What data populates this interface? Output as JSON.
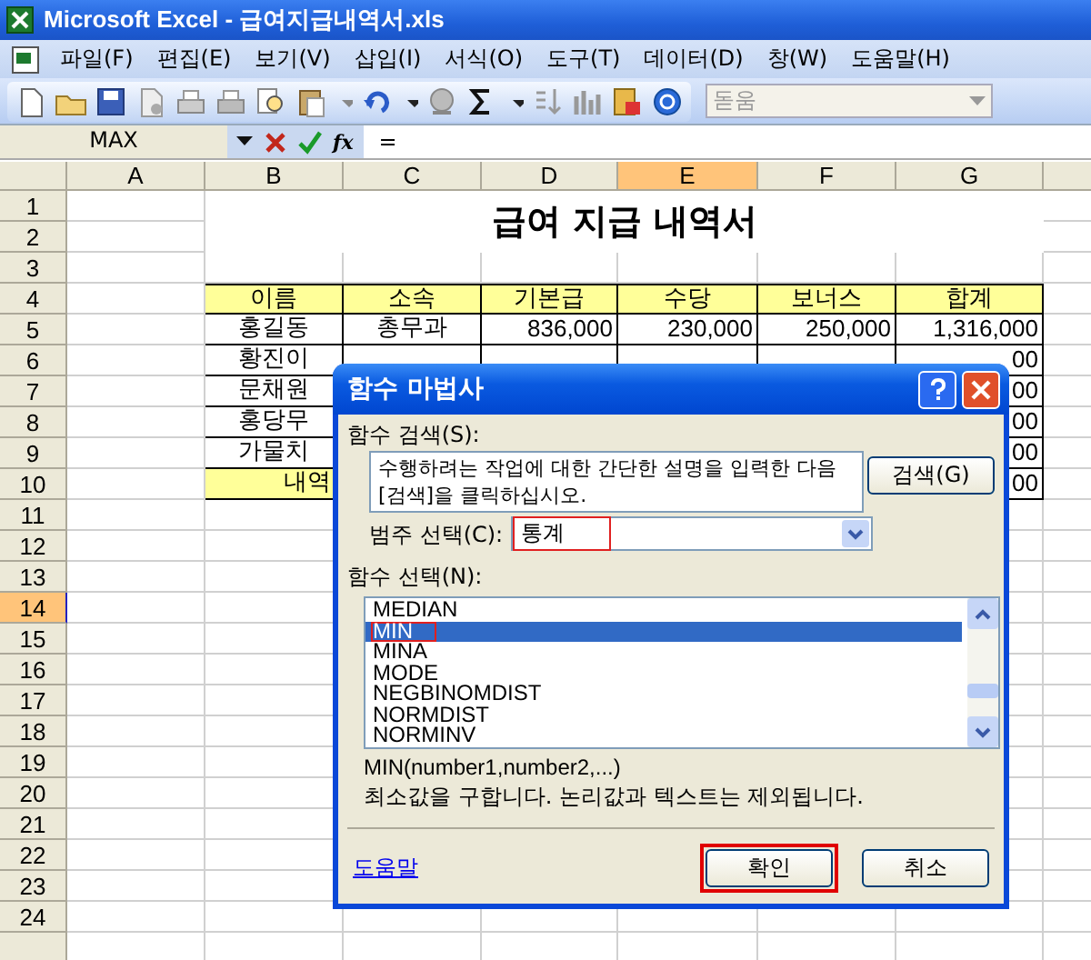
{
  "window": {
    "title": "Microsoft Excel - 급여지급내역서.xls"
  },
  "menu": [
    {
      "label": "파일(F)"
    },
    {
      "label": "편집(E)"
    },
    {
      "label": "보기(V)"
    },
    {
      "label": "삽입(I)"
    },
    {
      "label": "서식(O)"
    },
    {
      "label": "도구(T)"
    },
    {
      "label": "데이터(D)"
    },
    {
      "label": "창(W)"
    },
    {
      "label": "도움말(H)"
    }
  ],
  "font_box": {
    "value": "돋움",
    "disabled": true
  },
  "formula_bar": {
    "name_box": "MAX",
    "function_button": "fx",
    "formula": "="
  },
  "sheet": {
    "title": "급여 지급 내역서",
    "columns": [
      {
        "label": "A",
        "selected": false
      },
      {
        "label": "B",
        "selected": false
      },
      {
        "label": "C",
        "selected": false
      },
      {
        "label": "D",
        "selected": false
      },
      {
        "label": "E",
        "selected": true
      },
      {
        "label": "F",
        "selected": false
      },
      {
        "label": "G",
        "selected": false
      }
    ],
    "rows": [
      {
        "label": "1",
        "selected": false
      },
      {
        "label": "2",
        "selected": false
      },
      {
        "label": "3",
        "selected": false
      },
      {
        "label": "4",
        "selected": false,
        "cells": [
          {
            "kind": "blank"
          },
          {
            "kind": "header",
            "text": "이름"
          },
          {
            "kind": "header",
            "text": "소속"
          },
          {
            "kind": "header",
            "text": "기본급"
          },
          {
            "kind": "header",
            "text": "수당"
          },
          {
            "kind": "header",
            "text": "보너스"
          },
          {
            "kind": "header",
            "text": "합계"
          }
        ]
      },
      {
        "label": "5",
        "selected": false,
        "cells": [
          {
            "kind": "blank"
          },
          {
            "kind": "text",
            "text": "홍길동"
          },
          {
            "kind": "text",
            "text": "총무과"
          },
          {
            "kind": "number",
            "text": "836,000"
          },
          {
            "kind": "number",
            "text": "230,000"
          },
          {
            "kind": "number",
            "text": "250,000"
          },
          {
            "kind": "number",
            "text": "1,316,000"
          }
        ]
      },
      {
        "label": "6",
        "selected": false,
        "cells": [
          {
            "kind": "blank"
          },
          {
            "kind": "text",
            "text": "황진이"
          },
          {
            "kind": "box"
          },
          {
            "kind": "box"
          },
          {
            "kind": "box"
          },
          {
            "kind": "box"
          },
          {
            "kind": "number",
            "text": "00"
          }
        ]
      },
      {
        "label": "7",
        "selected": false,
        "cells": [
          {
            "kind": "blank"
          },
          {
            "kind": "text",
            "text": "문채원"
          },
          {
            "kind": "box"
          },
          {
            "kind": "box"
          },
          {
            "kind": "box"
          },
          {
            "kind": "box"
          },
          {
            "kind": "number",
            "text": "00"
          }
        ]
      },
      {
        "label": "8",
        "selected": false,
        "cells": [
          {
            "kind": "blank"
          },
          {
            "kind": "text",
            "text": "홍당무"
          },
          {
            "kind": "box"
          },
          {
            "kind": "box"
          },
          {
            "kind": "box"
          },
          {
            "kind": "box"
          },
          {
            "kind": "number",
            "text": "00"
          }
        ]
      },
      {
        "label": "9",
        "selected": false,
        "cells": [
          {
            "kind": "blank"
          },
          {
            "kind": "text",
            "text": "가물치"
          },
          {
            "kind": "box"
          },
          {
            "kind": "box"
          },
          {
            "kind": "box"
          },
          {
            "kind": "box"
          },
          {
            "kind": "number",
            "text": "00"
          }
        ]
      },
      {
        "label": "10",
        "selected": false,
        "cells": [
          {
            "kind": "blank"
          },
          {
            "kind": "total",
            "text": "내역"
          },
          {
            "kind": "box"
          },
          {
            "kind": "box"
          },
          {
            "kind": "box"
          },
          {
            "kind": "box"
          },
          {
            "kind": "number",
            "text": "00"
          }
        ]
      },
      {
        "label": "11",
        "selected": false
      },
      {
        "label": "12",
        "selected": false
      },
      {
        "label": "13",
        "selected": false
      },
      {
        "label": "14",
        "selected": true
      },
      {
        "label": "15",
        "selected": false
      },
      {
        "label": "16",
        "selected": false
      },
      {
        "label": "17",
        "selected": false
      },
      {
        "label": "18",
        "selected": false
      },
      {
        "label": "19",
        "selected": false
      },
      {
        "label": "20",
        "selected": false
      },
      {
        "label": "21",
        "selected": false
      },
      {
        "label": "22",
        "selected": false
      },
      {
        "label": "23",
        "selected": false
      },
      {
        "label": "24",
        "selected": false
      }
    ]
  },
  "dialog": {
    "title": "함수 마법사",
    "search_label": "함수 검색(S):",
    "search_text": "수행하려는 작업에 대한 간단한 설명을 입력한 다음 [검색]을 클릭하십시오.",
    "search_button": "검색(G)",
    "category_label": "범주 선택(C):",
    "category": {
      "value": "통계",
      "highlighted": true
    },
    "function_label": "함수 선택(N):",
    "functions": [
      {
        "label": "MEDIAN",
        "selected": false,
        "highlighted": false
      },
      {
        "label": "MIN",
        "selected": true,
        "highlighted": true
      },
      {
        "label": "MINA",
        "selected": false,
        "highlighted": false
      },
      {
        "label": "MODE",
        "selected": false,
        "highlighted": false
      },
      {
        "label": "NEGBINOMDIST",
        "selected": false,
        "highlighted": false
      },
      {
        "label": "NORMDIST",
        "selected": false,
        "highlighted": false
      },
      {
        "label": "NORMINV",
        "selected": false,
        "highlighted": false
      }
    ],
    "syntax": "MIN(number1,number2,...)",
    "description": "최소값을 구합니다. 논리값과 텍스트는 제외됩니다.",
    "help_link": "도움말",
    "buttons": [
      {
        "label": "확인",
        "highlighted": true
      },
      {
        "label": "취소",
        "highlighted": false
      }
    ]
  }
}
